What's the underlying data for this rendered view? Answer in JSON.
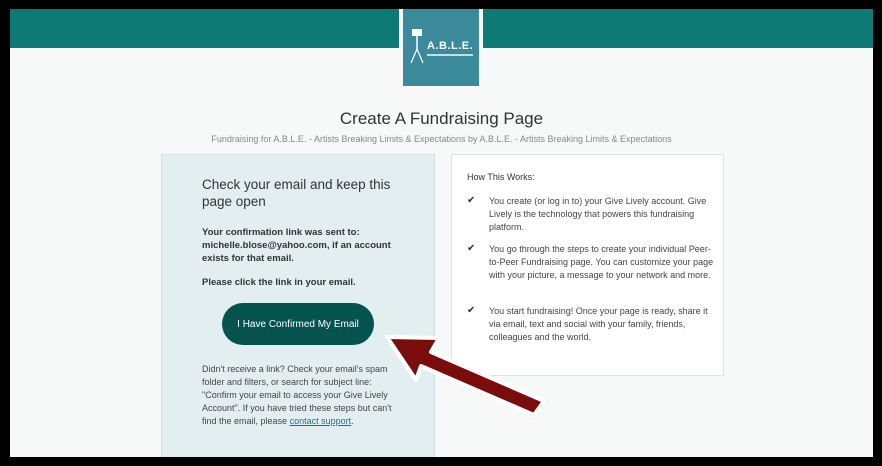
{
  "header": {
    "logo_text": "A.B.L.E.",
    "title": "Create A Fundraising Page",
    "subtitle": "Fundraising for A.B.L.E. - Artists Breaking Limits & Expectations by A.B.L.E. - Artists Breaking Limits & Expectations"
  },
  "left": {
    "heading": "Check your email and keep this page open",
    "sent_prefix": "Your confirmation link was sent to:",
    "email": "michelle.blose@yahoo.com",
    "sent_suffix": ", if an account exists for that email.",
    "click_text": "Please click the link in your email.",
    "confirm_button": "I Have Confirmed My Email",
    "help_text": "Didn't receive a link? Check your email's spam folder and filters, or search for subject line: \"Confirm your email to access your Give Lively Account\". If you have tried these steps but can't find the email, please ",
    "contact_link": "contact support",
    "help_end": "."
  },
  "right": {
    "title": "How This Works:",
    "steps": [
      "You create (or log in to) your Give Lively account. Give Lively is the technology that powers this fundraising platform.",
      "You go through the steps to create your individual Peer-to-Peer Fundraising page. You can customize your page with your picture, a message to your network and more.",
      "You start fundraising! Once your page is ready, share it via email, text and social with your family, friends, colleagues and the world."
    ]
  },
  "colors": {
    "brand": "#0e7a76",
    "button": "#05534f",
    "arrow": "#7a0c0c"
  }
}
